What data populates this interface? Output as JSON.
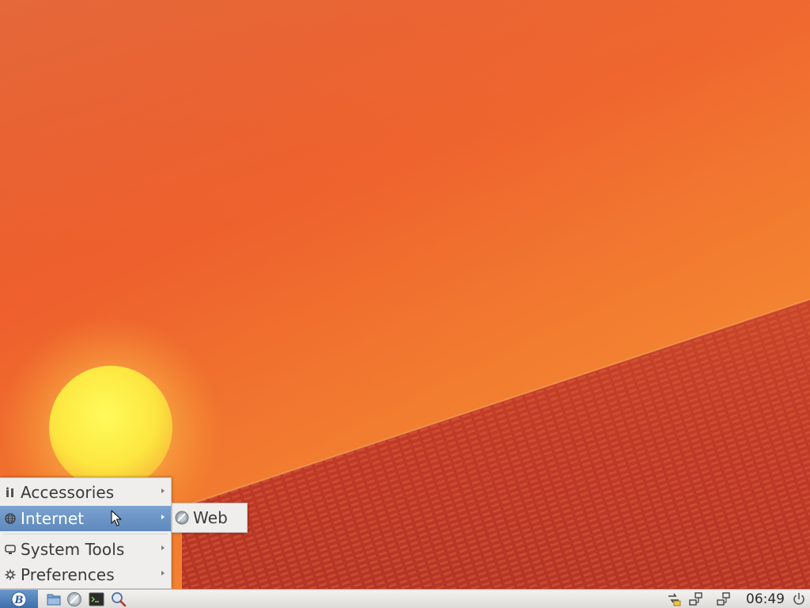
{
  "menu": {
    "items": [
      {
        "label": "Accessories",
        "icon": "accessories-icon"
      },
      {
        "label": "Internet",
        "icon": "globe-icon"
      },
      {
        "label": "System Tools",
        "icon": "monitor-icon"
      },
      {
        "label": "Preferences",
        "icon": "gear-icon"
      }
    ],
    "active_item": "Internet",
    "submenu": {
      "items": [
        {
          "label": "Web",
          "icon": "web-browser-icon"
        }
      ]
    }
  },
  "taskbar": {
    "start_icon": "start-menu-logo-icon",
    "start_letter": "B",
    "launchers": [
      "file-manager-icon",
      "web-browser-icon",
      "terminal-icon",
      "search-icon"
    ],
    "tray_icons": [
      "updates-icon",
      "network-icon",
      "network-icon"
    ],
    "clock": "06:49",
    "power_icon": "power-icon"
  },
  "colors": {
    "menu_highlight": "#6b94c6",
    "start_button": "#4f80ba"
  }
}
